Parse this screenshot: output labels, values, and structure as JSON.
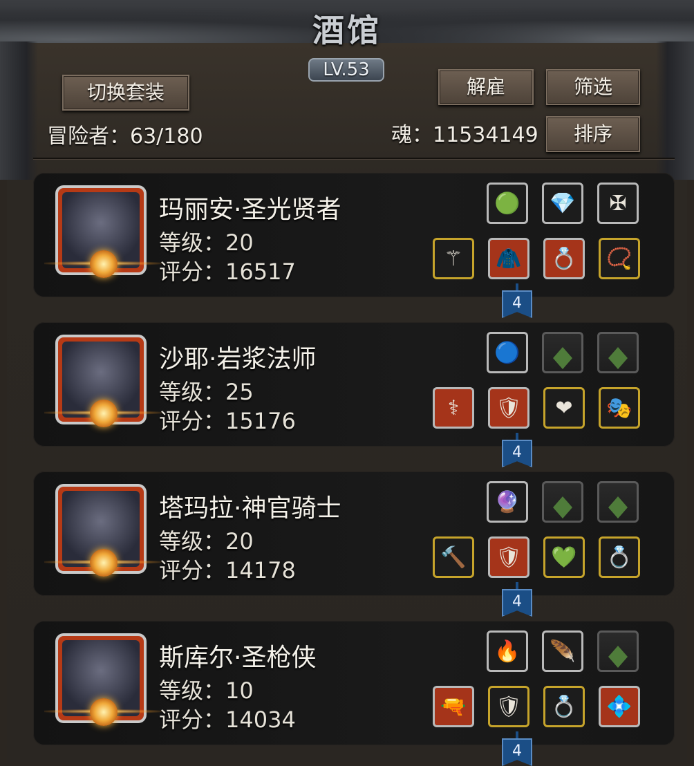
{
  "header": {
    "title": "酒馆",
    "level": "LV.53",
    "switch_outfit_label": "切换套装",
    "dismiss_label": "解雇",
    "filter_label": "筛选",
    "sort_label": "排序",
    "adventurers_text": "冒险者：63/180",
    "soul_text": "魂：11534149"
  },
  "heroes": [
    {
      "name": "玛丽安·圣光贤者",
      "level_text": "等级：20",
      "score_text": "评分：16517",
      "chain_count": "4",
      "top_slots": [
        {
          "icon": "green-gem-icon",
          "glyph": "🟢",
          "frame": "silver"
        },
        {
          "icon": "purple-crystal-icon",
          "glyph": "💎",
          "frame": "silver"
        },
        {
          "icon": "silver-sigil-icon",
          "glyph": "✠",
          "frame": "silver"
        }
      ],
      "bottom_slots": [
        {
          "icon": "staff-icon",
          "glyph": "⚚",
          "frame": "gold"
        },
        {
          "icon": "robe-icon",
          "glyph": "🧥",
          "frame": "red"
        },
        {
          "icon": "ruby-ring-icon",
          "glyph": "💍",
          "frame": "red"
        },
        {
          "icon": "amulet-icon",
          "glyph": "📿",
          "frame": "gold"
        }
      ]
    },
    {
      "name": "沙耶·岩浆法师",
      "level_text": "等级：25",
      "score_text": "评分：15176",
      "chain_count": "4",
      "top_slots": [
        {
          "icon": "blue-orb-icon",
          "glyph": "🔵",
          "frame": "silver"
        },
        {
          "icon": "empty-slot-icon",
          "glyph": "",
          "frame": "empty"
        },
        {
          "icon": "empty-slot-icon",
          "glyph": "",
          "frame": "empty"
        }
      ],
      "bottom_slots": [
        {
          "icon": "wand-icon",
          "glyph": "⚕",
          "frame": "red"
        },
        {
          "icon": "green-armor-icon",
          "glyph": "🛡",
          "frame": "red"
        },
        {
          "icon": "heart-necklace-icon",
          "glyph": "❤",
          "frame": "gold"
        },
        {
          "icon": "mask-icon",
          "glyph": "🎭",
          "frame": "gold"
        }
      ]
    },
    {
      "name": "塔玛拉·神官骑士",
      "level_text": "等级：20",
      "score_text": "评分：14178",
      "chain_count": "4",
      "top_slots": [
        {
          "icon": "dark-crystal-icon",
          "glyph": "🔮",
          "frame": "silver"
        },
        {
          "icon": "empty-slot-icon",
          "glyph": "",
          "frame": "empty"
        },
        {
          "icon": "empty-slot-icon",
          "glyph": "",
          "frame": "empty"
        }
      ],
      "bottom_slots": [
        {
          "icon": "mace-icon",
          "glyph": "🔨",
          "frame": "gold"
        },
        {
          "icon": "plate-armor-icon",
          "glyph": "🛡",
          "frame": "red"
        },
        {
          "icon": "emerald-ring-icon",
          "glyph": "💚",
          "frame": "gold"
        },
        {
          "icon": "gold-ring-icon",
          "glyph": "💍",
          "frame": "gold"
        }
      ]
    },
    {
      "name": "斯库尔·圣枪侠",
      "level_text": "等级：10",
      "score_text": "评分：14034",
      "chain_count": "4",
      "top_slots": [
        {
          "icon": "fire-orb-icon",
          "glyph": "🔥",
          "frame": "silver"
        },
        {
          "icon": "feather-icon",
          "glyph": "🪶",
          "frame": "silver"
        },
        {
          "icon": "empty-slot-icon",
          "glyph": "",
          "frame": "empty"
        }
      ],
      "bottom_slots": [
        {
          "icon": "pistol-icon",
          "glyph": "🔫",
          "frame": "red"
        },
        {
          "icon": "iron-armor-icon",
          "glyph": "🛡",
          "frame": "gold"
        },
        {
          "icon": "jade-ring-icon",
          "glyph": "💍",
          "frame": "gold"
        },
        {
          "icon": "blue-bracelet-icon",
          "glyph": "💠",
          "frame": "red"
        }
      ]
    }
  ],
  "colors": {
    "panel_bg": "#2b2621",
    "card_bg": "#151515",
    "portrait_red": "#b63a16",
    "gold_frame": "#c6a42b",
    "chain_blue": "#1b4e86"
  }
}
